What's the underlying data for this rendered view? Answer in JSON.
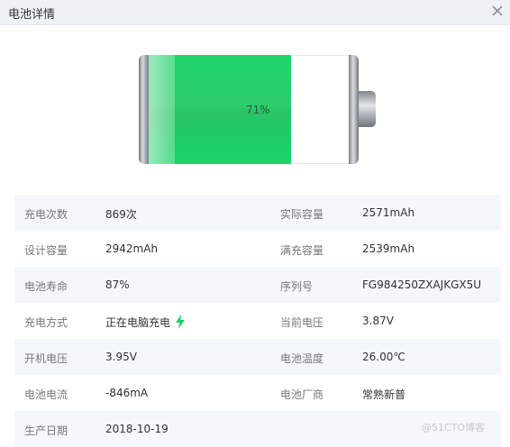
{
  "window": {
    "title": "电池详情"
  },
  "battery": {
    "percent_text": "71%",
    "level": 0.71,
    "fill_color": "#1fd46b"
  },
  "details": [
    {
      "label1": "充电次数",
      "value1": "869次",
      "label2": "实际容量",
      "value2": "2571mAh"
    },
    {
      "label1": "设计容量",
      "value1": "2942mAh",
      "label2": "满充容量",
      "value2": "2539mAh"
    },
    {
      "label1": "电池寿命",
      "value1": "87%",
      "label2": "序列号",
      "value2": "FG984250ZXAJKGX5U"
    },
    {
      "label1": "充电方式",
      "value1": "正在电脑充电",
      "label2": "当前电压",
      "value2": "3.87V"
    },
    {
      "label1": "开机电压",
      "value1": "3.95V",
      "label2": "电池温度",
      "value2": "26.00℃"
    },
    {
      "label1": "电池电流",
      "value1": "-846mA",
      "label2": "电池厂商",
      "value2": "常熟新普"
    },
    {
      "label1": "生产日期",
      "value1": "2018-10-19",
      "label2": "",
      "value2": ""
    }
  ],
  "icons": {
    "close": "close-icon",
    "charging": "lightning-bolt-icon"
  },
  "watermark": "@51CTO博客"
}
